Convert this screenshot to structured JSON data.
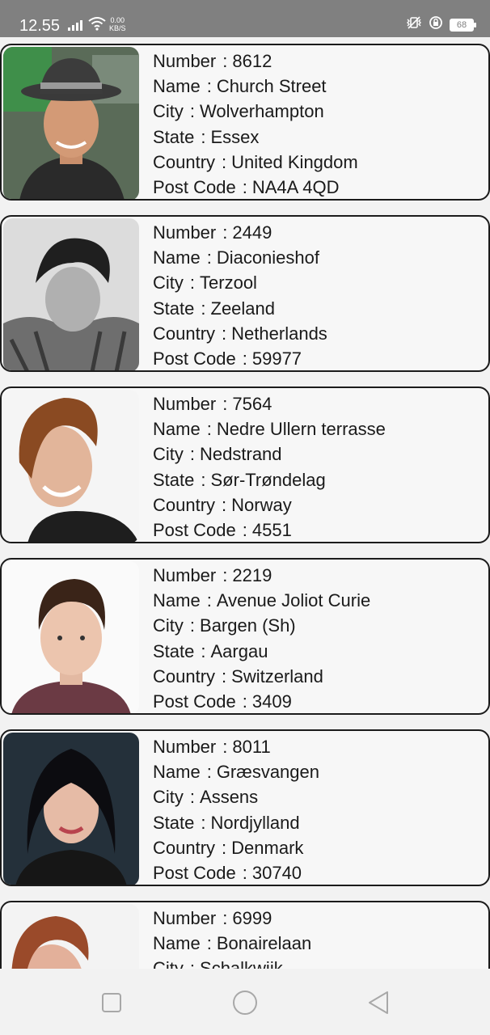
{
  "status_bar": {
    "time": "12.55",
    "net_speed_value": "0.00",
    "net_speed_unit": "KB/S",
    "battery": "68",
    "icons": [
      "signal-icon",
      "wifi-icon",
      "vibrate-icon",
      "alarm-icon",
      "battery-icon"
    ]
  },
  "labels": {
    "number": "Number",
    "name": "Name",
    "city": "City",
    "state": "State",
    "country": "Country",
    "post_code": "Post Code",
    "sep": ":"
  },
  "people": [
    {
      "number": "8612",
      "name": "Church Street",
      "city": "Wolverhampton",
      "state": "Essex",
      "country": "United Kingdom",
      "post_code": "NA4A 4QD"
    },
    {
      "number": "2449",
      "name": "Diaconieshof",
      "city": "Terzool",
      "state": "Zeeland",
      "country": "Netherlands",
      "post_code": "59977"
    },
    {
      "number": "7564",
      "name": "Nedre Ullern terrasse",
      "city": "Nedstrand",
      "state": "Sør-Trøndelag",
      "country": "Norway",
      "post_code": "4551"
    },
    {
      "number": "2219",
      "name": "Avenue Joliot Curie",
      "city": "Bargen (Sh)",
      "state": "Aargau",
      "country": "Switzerland",
      "post_code": "3409"
    },
    {
      "number": "8011",
      "name": "Græsvangen",
      "city": "Assens",
      "state": "Nordjylland",
      "country": "Denmark",
      "post_code": "30740"
    },
    {
      "number": "6999",
      "name": "Bonairelaan",
      "city": "Schalkwijk"
    }
  ],
  "nav": [
    "recent-apps-button",
    "home-button",
    "back-button"
  ]
}
